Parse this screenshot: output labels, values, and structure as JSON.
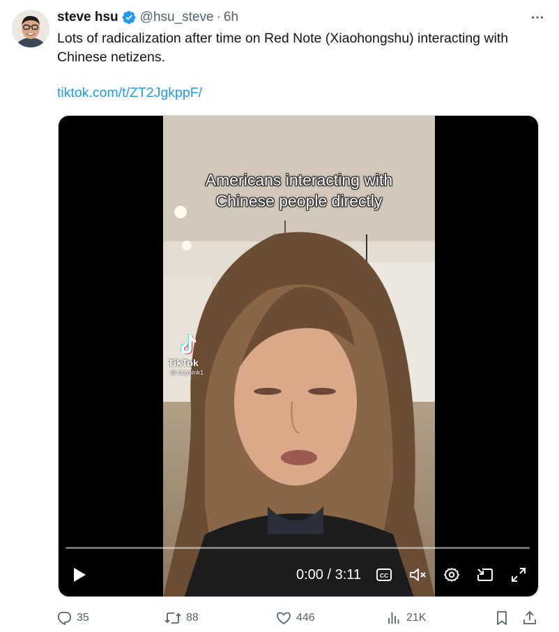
{
  "author": {
    "display_name": "steve hsu",
    "handle": "@hsu_steve",
    "separator": "·",
    "timestamp": "6h",
    "verified": true,
    "avatar_icon": "avatar-photo"
  },
  "tweet": {
    "text": "Lots of radicalization after time on Red Note (Xiaohongshu) interacting with Chinese netizens.",
    "link": "tiktok.com/t/ZT2JgkppF/"
  },
  "video": {
    "caption_line1": "Americans interacting with",
    "caption_line2": "Chinese people directly",
    "watermark_brand": "TikTok",
    "watermark_user": "@ izzysink1",
    "current_time": "0:00",
    "duration": "3:11",
    "time_display": "0:00 / 3:11",
    "progress_fraction": 0,
    "muted": true
  },
  "actions": {
    "replies": "35",
    "reposts": "88",
    "likes": "446",
    "views": "21K"
  },
  "colors": {
    "accent": "#1d9bf0",
    "text_primary": "#0f1419",
    "text_secondary": "#536471"
  }
}
